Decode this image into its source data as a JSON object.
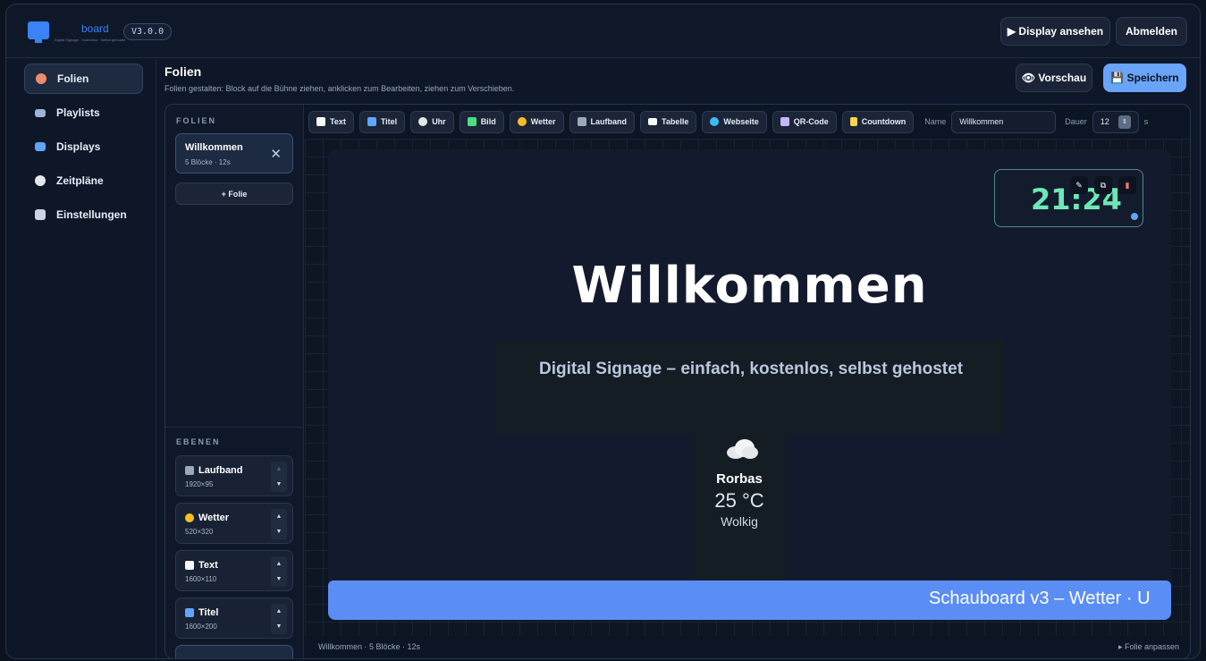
{
  "header": {
    "brand": "board",
    "tagline": "Digital Signage · Kostenlos · Selbst gehostet",
    "version": "V3.0.0",
    "display_button": "▶ Display ansehen",
    "logout_button": "Abmelden"
  },
  "sidebar": {
    "items": [
      {
        "label": "Folien",
        "icon": "palette-icon",
        "color": "#f08a6c"
      },
      {
        "label": "Playlists",
        "icon": "film-icon",
        "color": "#9db4d6"
      },
      {
        "label": "Displays",
        "icon": "monitor-icon",
        "color": "#60a5fa"
      },
      {
        "label": "Zeitpläne",
        "icon": "clock-icon",
        "color": "#e5e7eb"
      },
      {
        "label": "Einstellungen",
        "icon": "gear-icon",
        "color": "#cbd5e1"
      }
    ]
  },
  "page": {
    "title": "Folien",
    "subtitle": "Folien gestalten: Block auf die Bühne ziehen, anklicken zum Bearbeiten, ziehen zum Verschieben.",
    "preview_button": "👁 Vorschau",
    "save_button": "💾 Speichern"
  },
  "slides": {
    "section_label": "FOLIEN",
    "items": [
      {
        "title": "Willkommen",
        "meta": "5 Blöcke · 12s"
      }
    ],
    "add_label": "+ Folie"
  },
  "layers": {
    "section_label": "EBENEN",
    "items": [
      {
        "name": "Laufband",
        "size": "1920×95",
        "color": "#9aa8bc"
      },
      {
        "name": "Wetter",
        "size": "520×320",
        "color": "#fbbf24"
      },
      {
        "name": "Text",
        "size": "1600×110",
        "color": "#f8fafc"
      },
      {
        "name": "Titel",
        "size": "1600×200",
        "color": "#60a5fa"
      }
    ]
  },
  "toolbar": {
    "tools": [
      "Text",
      "Titel",
      "Uhr",
      "Bild",
      "Wetter",
      "Laufband",
      "Tabelle",
      "Webseite",
      "QR-Code",
      "Countdown"
    ],
    "name_label": "Name",
    "name_value": "Willkommen",
    "duration_label": "Dauer",
    "duration_value": "12",
    "duration_unit": "s"
  },
  "stage": {
    "clock_time": "21:24",
    "headline": "Willkommen",
    "subline": "Digital Signage – einfach, kostenlos, selbst gehostet",
    "weather": {
      "city": "Rorbas",
      "temp": "25 °C",
      "desc": "Wolkig"
    },
    "ticker": "Schauboard v3 – Wetter · U"
  },
  "status": {
    "left": "Willkommen · 5 Blöcke · 12s",
    "right": "▸ Folie anpassen"
  }
}
